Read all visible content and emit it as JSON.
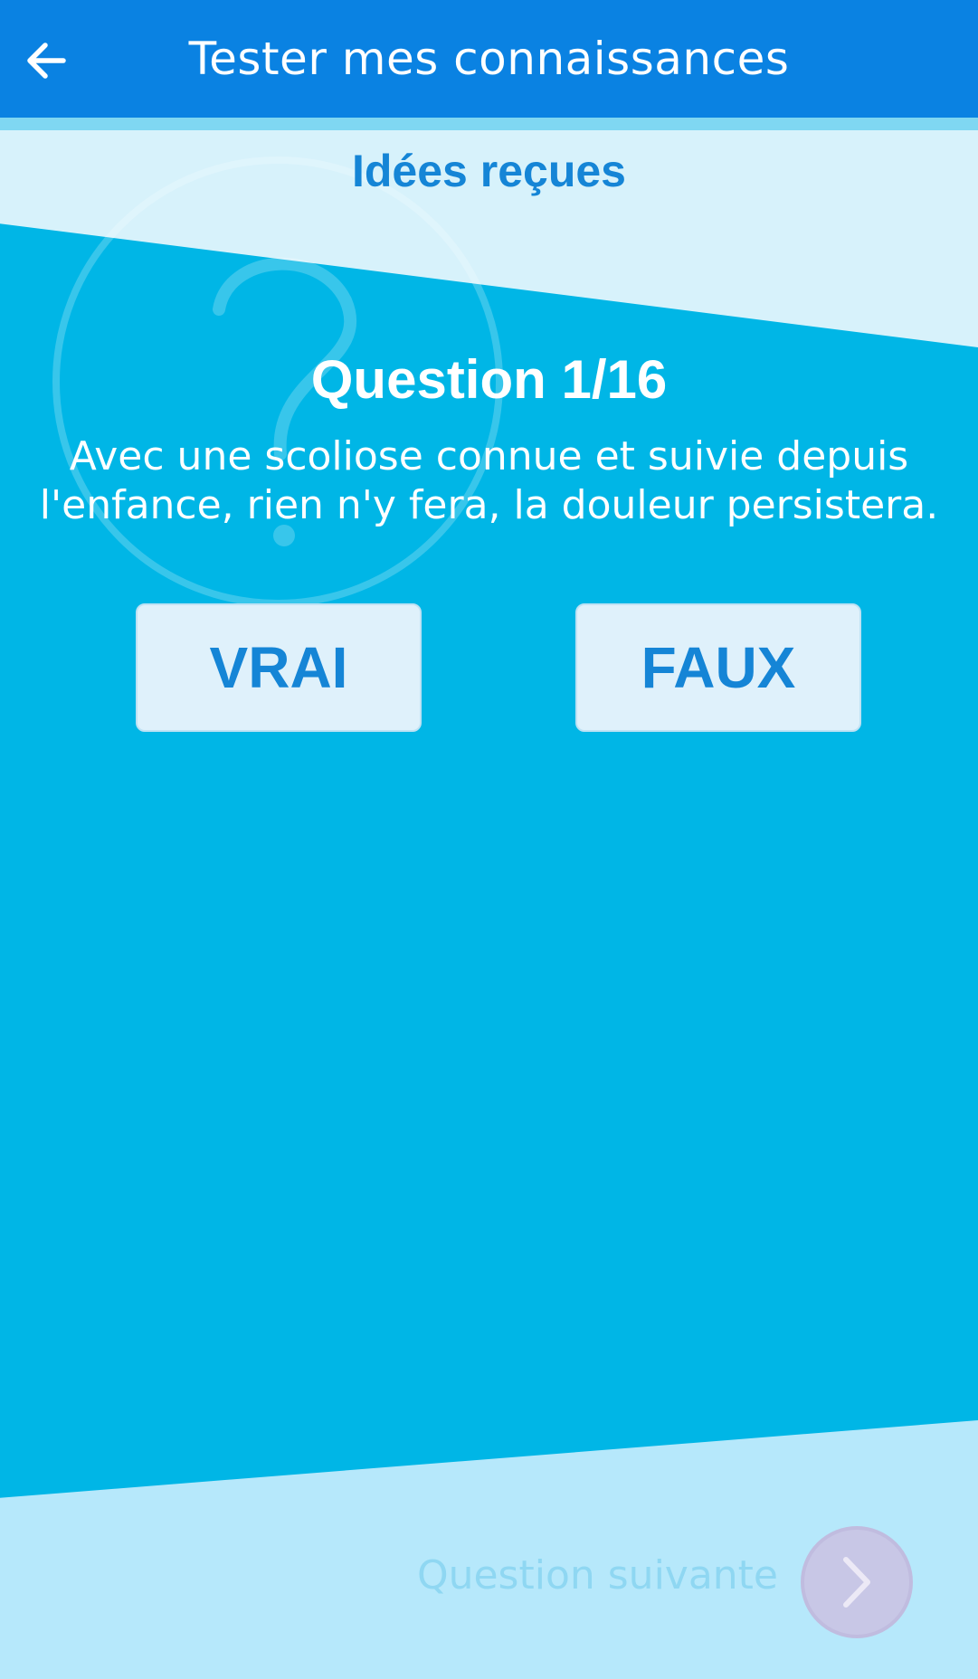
{
  "header": {
    "title": "Tester mes connaissances",
    "back_icon": "arrow-left-icon"
  },
  "section": {
    "title": "Idées reçues"
  },
  "quiz": {
    "question_label": "Question 1/16",
    "question_text": "Avec une scoliose connue et suivie depuis l'enfance, rien n'y fera, la douleur persistera.",
    "true_label": "VRAI",
    "false_label": "FAUX"
  },
  "footer": {
    "next_label": "Question suivante",
    "next_icon": "chevron-right-icon"
  },
  "colors": {
    "app_bar": "#0a82e2",
    "main_background": "#00b6e6",
    "top_band": "#d7f2fb",
    "bottom_band": "#b6e8fb",
    "accent_text": "#1585d6",
    "button_background": "#dff1fb",
    "next_button_disabled": "#c8c7e6"
  }
}
